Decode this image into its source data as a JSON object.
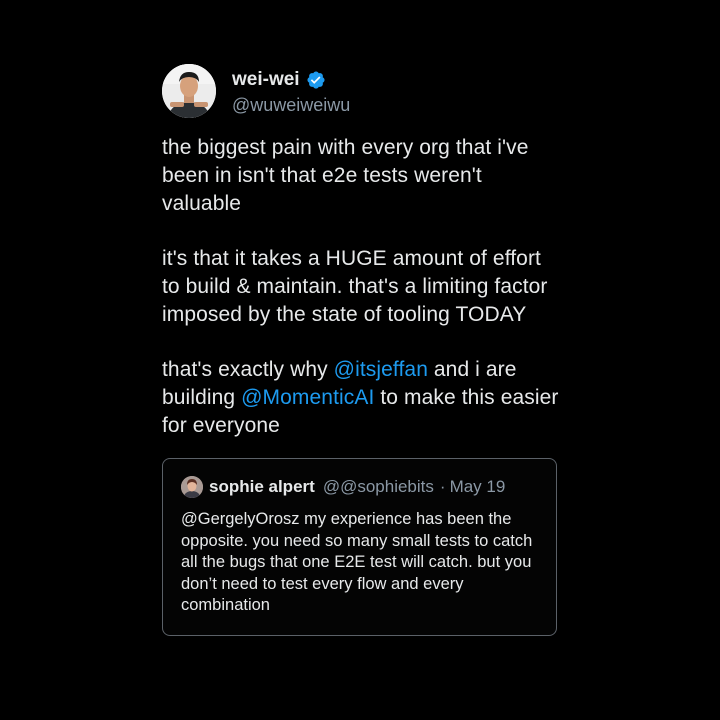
{
  "author": {
    "name": "wei-wei",
    "handle": "@wuweiweiwu",
    "verified": true
  },
  "tweet": {
    "paragraph1": "the biggest pain with every org that i've been in isn't that e2e tests weren't valuable",
    "paragraph2": "it's that it takes a HUGE amount of effort to build & maintain. that's a limiting factor imposed by the state of tooling TODAY",
    "p3_before": "that's exactly why ",
    "p3_mention1": "@itsjeffan",
    "p3_middle": " and i are building ",
    "p3_mention2": "@MomenticAI",
    "p3_after": " to make this easier for everyone"
  },
  "quote": {
    "name": "sophie alpert",
    "handle": "@@sophiebits",
    "separator": "·",
    "date": "May 19",
    "text": "@GergelyOrosz my experience has been the opposite. you need so many small tests to catch all the bugs that one E2E test will catch. but you don’t need to test every flow and every combination"
  },
  "colors": {
    "background": "#000000",
    "text": "#e7e9ea",
    "secondary": "#8b98a5",
    "mention": "#1d9bf0",
    "verified": "#1d9bf0",
    "quote_border": "#5b6168"
  },
  "icons": [
    "verified-badge-icon"
  ]
}
